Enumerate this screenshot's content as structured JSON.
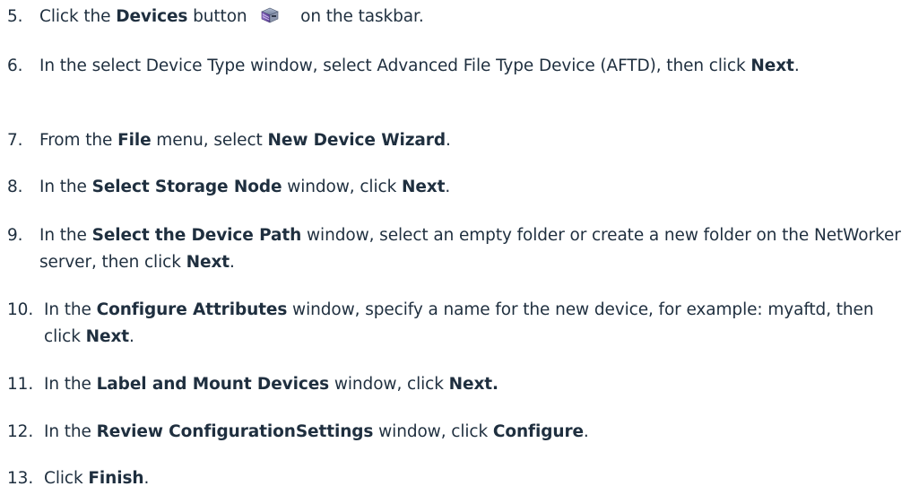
{
  "steps": [
    {
      "num": "5.",
      "parts": [
        "Click the ",
        "Devices",
        " button ",
        " on the taskbar."
      ]
    },
    {
      "num": "6.",
      "parts": [
        "In the select Device Type window, select Advanced File Type Device (AFTD), then click ",
        "Next",
        "."
      ]
    },
    {
      "num": "7.",
      "parts": [
        "From the ",
        "File",
        " menu, select ",
        "New Device Wizard",
        "."
      ]
    },
    {
      "num": "8.",
      "parts": [
        "In the ",
        "Select Storage Node",
        " window, click ",
        "Next",
        "."
      ]
    },
    {
      "num": "9.",
      "parts": [
        "In the ",
        "Select the Device Path",
        " window, select an empty folder or create a new folder on the NetWorker server, then click ",
        "Next",
        "."
      ]
    },
    {
      "num": "10.",
      "parts": [
        "In the ",
        "Configure Attributes",
        " window, specify a name for the new device, for example: myaftd, then click ",
        "Next",
        "."
      ]
    },
    {
      "num": "11.",
      "parts": [
        "In the ",
        "Label and Mount Devices",
        " window, click ",
        "Next.",
        ""
      ]
    },
    {
      "num": "12.",
      "parts": [
        "In the ",
        "Review ConfigurationSettings",
        " window, click ",
        "Configure",
        "."
      ]
    },
    {
      "num": "13.",
      "parts": [
        "Click ",
        "Finish",
        "."
      ]
    }
  ],
  "icons": {
    "devices": "devices-icon"
  }
}
